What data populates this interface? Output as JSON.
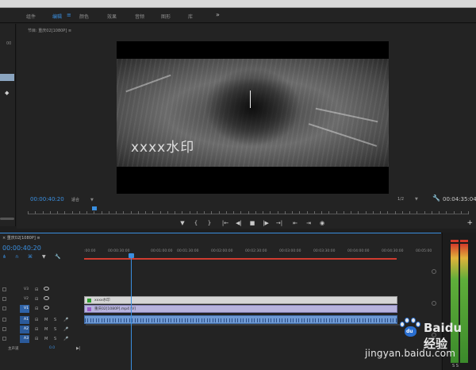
{
  "workspaces": {
    "tabs": [
      {
        "label": "组件"
      },
      {
        "label": "编辑"
      },
      {
        "label": "颜色"
      },
      {
        "label": "效果"
      },
      {
        "label": "音频"
      },
      {
        "label": "图形"
      },
      {
        "label": "库"
      }
    ],
    "active": "编辑",
    "more": "»"
  },
  "left_panel": {
    "mark": "00"
  },
  "monitor": {
    "title": "节目: 重庆02[1080P] ≡",
    "watermark": "xxxx水印",
    "timecode": "00:00:40:20",
    "fit": "适合",
    "resolution": "1/2",
    "duration": "00:04:35:04"
  },
  "transport": {
    "buttons": [
      "▼",
      "{",
      "}",
      "|←",
      "◀|",
      "■",
      "|▶",
      "→|",
      "⇤",
      "⇥",
      "◉"
    ],
    "add": "+"
  },
  "timeline": {
    "title": "× 重庆02[1080P] ≡",
    "timecode": "00:00:40:20",
    "ruler_labels": [
      ":00:00",
      "00:00:30:00",
      "00:01:00:00",
      "00:01:30:00",
      "00:02:00:00",
      "00:02:30:00",
      "00:03:00:00",
      "00:03:30:00",
      "00:04:00:00",
      "00:04:30:00",
      "00:05:00"
    ],
    "tracks": [
      {
        "name": "V3",
        "kind": "video"
      },
      {
        "name": "V2",
        "kind": "video"
      },
      {
        "name": "V1",
        "kind": "video"
      },
      {
        "name": "A1",
        "kind": "audio"
      },
      {
        "name": "A2",
        "kind": "audio"
      },
      {
        "name": "A3",
        "kind": "audio"
      }
    ],
    "master_label": "主声道",
    "master_value": "0.0",
    "clips": {
      "title": "xxxx水印",
      "video": "重庆02[1080P].mp4 [V]"
    }
  },
  "watermark_brand": {
    "name": "Baidu 经验",
    "paw_label": "du",
    "url": "jingyan.baidu.com"
  }
}
